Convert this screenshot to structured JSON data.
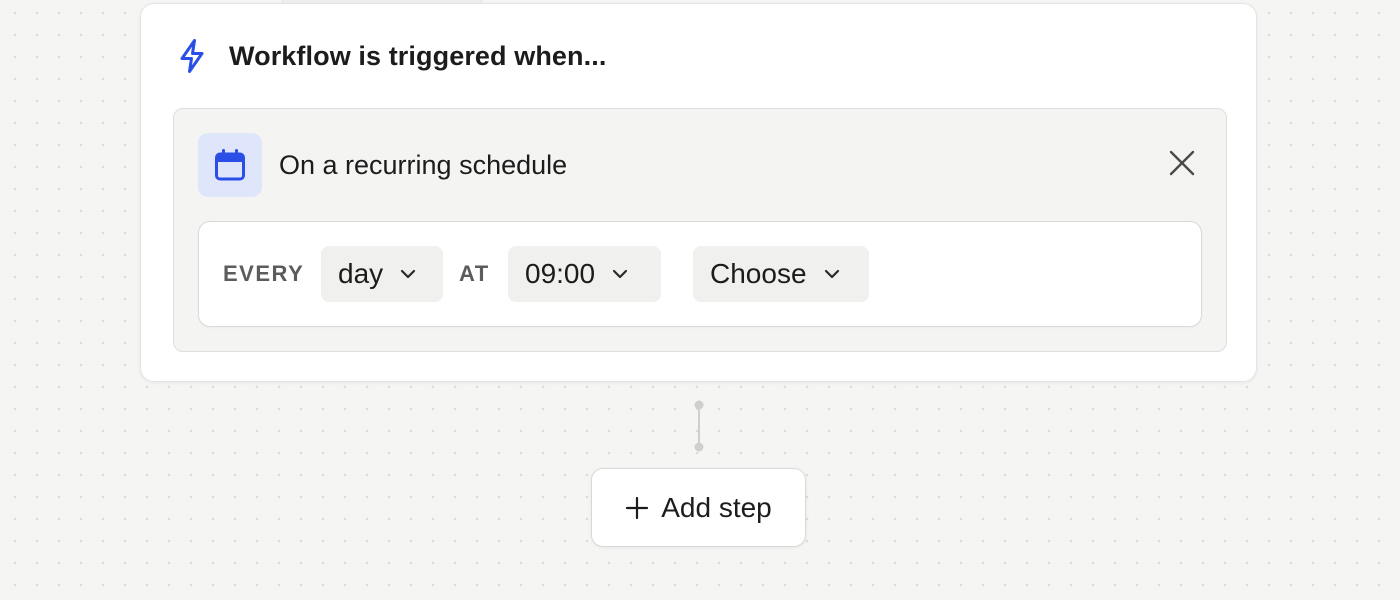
{
  "colors": {
    "accent": "#2b4ee6",
    "icon_bg": "#dfe6fb",
    "canvas": "#f5f5f4"
  },
  "trigger": {
    "header_icon": "lightning-bolt-icon",
    "title": "Workflow is triggered when...",
    "item": {
      "icon": "calendar-icon",
      "label": "On a recurring schedule",
      "close_icon": "close-icon"
    },
    "schedule": {
      "every_label": "EVERY",
      "interval": "day",
      "at_label": "AT",
      "time": "09:00",
      "extra": "Choose",
      "chevron_icon": "chevron-down-icon"
    }
  },
  "add_step": {
    "icon": "plus-icon",
    "label": "Add step"
  }
}
